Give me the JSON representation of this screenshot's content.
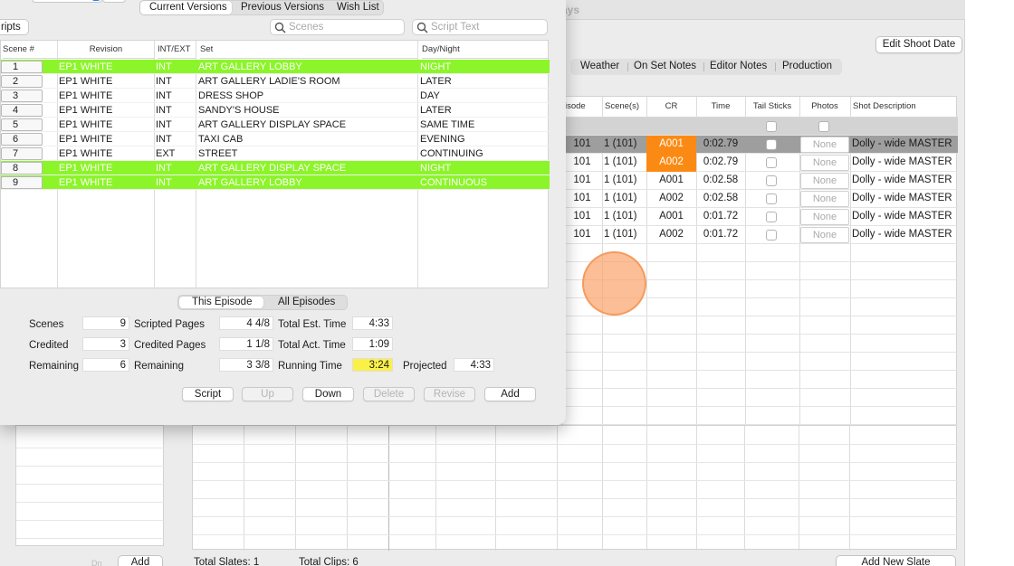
{
  "bg_window": {
    "title_partial": "ays",
    "edit_shoot_date": "Edit Shoot Date",
    "tabs": [
      "Weather",
      "On Set Notes",
      "Editor Notes",
      "Production"
    ],
    "slate_columns": [
      "isode",
      "Scene(s)",
      "CR",
      "Time",
      "Tail Sticks",
      "Photos",
      "Shot Description"
    ],
    "slates": [
      {
        "episode": "101",
        "scene": "1 (101)",
        "cr": "A001",
        "time": "0:02.79",
        "photos": "None",
        "desc": "Dolly - wide MASTER"
      },
      {
        "episode": "101",
        "scene": "1 (101)",
        "cr": "A002",
        "time": "0:02.79",
        "photos": "None",
        "desc": "Dolly - wide MASTER"
      },
      {
        "episode": "101",
        "scene": "1 (101)",
        "cr": "A001",
        "time": "0:02.58",
        "photos": "None",
        "desc": "Dolly - wide MASTER"
      },
      {
        "episode": "101",
        "scene": "1 (101)",
        "cr": "A002",
        "time": "0:02.58",
        "photos": "None",
        "desc": "Dolly - wide MASTER"
      },
      {
        "episode": "101",
        "scene": "1 (101)",
        "cr": "A001",
        "time": "0:01.72",
        "photos": "None",
        "desc": "Dolly - wide MASTER"
      },
      {
        "episode": "101",
        "scene": "1 (101)",
        "cr": "A002",
        "time": "0:01.72",
        "photos": "None",
        "desc": "Dolly - wide MASTER"
      }
    ],
    "cr_highlight_color": "#fb8a14",
    "total_slates": "Total Slates: 1",
    "total_clips": "Total Clips: 6",
    "add_new_slate": "Add New Slate",
    "left_dn": "Dn",
    "left_add": "Add"
  },
  "front": {
    "scripts_button": "ripts",
    "version_tabs": [
      "Current Versions",
      "Previous Versions",
      "Wish List"
    ],
    "scenes_search_placeholder": "Scenes",
    "script_search_placeholder": "Script Text",
    "columns": [
      "Scene #",
      "Revision",
      "INT/EXT",
      "Set",
      "Day/Night"
    ],
    "highlight_color": "#8cf52a",
    "rows": [
      {
        "num": "1",
        "rev": "EP1 WHITE",
        "ie": "INT",
        "set": "ART GALLERY LOBBY",
        "dn": "NIGHT",
        "hl": true
      },
      {
        "num": "2",
        "rev": "EP1 WHITE",
        "ie": "INT",
        "set": "ART GALLERY LADIE'S ROOM",
        "dn": "LATER",
        "hl": false
      },
      {
        "num": "3",
        "rev": "EP1 WHITE",
        "ie": "INT",
        "set": "DRESS SHOP",
        "dn": "DAY",
        "hl": false
      },
      {
        "num": "4",
        "rev": "EP1 WHITE",
        "ie": "INT",
        "set": "SANDY'S HOUSE",
        "dn": "LATER",
        "hl": false
      },
      {
        "num": "5",
        "rev": "EP1 WHITE",
        "ie": "INT",
        "set": "ART GALLERY DISPLAY SPACE",
        "dn": "SAME TIME",
        "hl": false
      },
      {
        "num": "6",
        "rev": "EP1 WHITE",
        "ie": "INT",
        "set": "TAXI CAB",
        "dn": "EVENING",
        "hl": false
      },
      {
        "num": "7",
        "rev": "EP1 WHITE",
        "ie": "EXT",
        "set": "STREET",
        "dn": "CONTINUING",
        "hl": false
      },
      {
        "num": "8",
        "rev": "EP1 WHITE",
        "ie": "INT",
        "set": "ART GALLERY DISPLAY SPACE",
        "dn": "NIGHT",
        "hl": true
      },
      {
        "num": "9",
        "rev": "EP1 WHITE",
        "ie": "INT",
        "set": "ART GALLERY LOBBY",
        "dn": "CONTINUOUS",
        "hl": true
      }
    ],
    "episode_tabs": [
      "This Episode",
      "All Episodes"
    ],
    "stats": {
      "scenes_label": "Scenes",
      "scenes": "9",
      "credited_label": "Credited",
      "credited": "3",
      "remaining_label": "Remaining",
      "remaining": "6",
      "scripted_pages_label": "Scripted Pages",
      "scripted_pages": "4 4/8",
      "credited_pages_label": "Credited Pages",
      "credited_pages": "1 1/8",
      "remaining_pages_label": "Remaining",
      "remaining_pages": "3 3/8",
      "total_est_label": "Total Est. Time",
      "total_est": "4:33",
      "total_act_label": "Total Act. Time",
      "total_act": "1:09",
      "running_label": "Running Time",
      "running": "3:24",
      "projected_label": "Projected",
      "projected": "4:33"
    },
    "actions": {
      "script": "Script",
      "up": "Up",
      "down": "Down",
      "delete": "Delete",
      "revise": "Revise",
      "add": "Add"
    }
  }
}
